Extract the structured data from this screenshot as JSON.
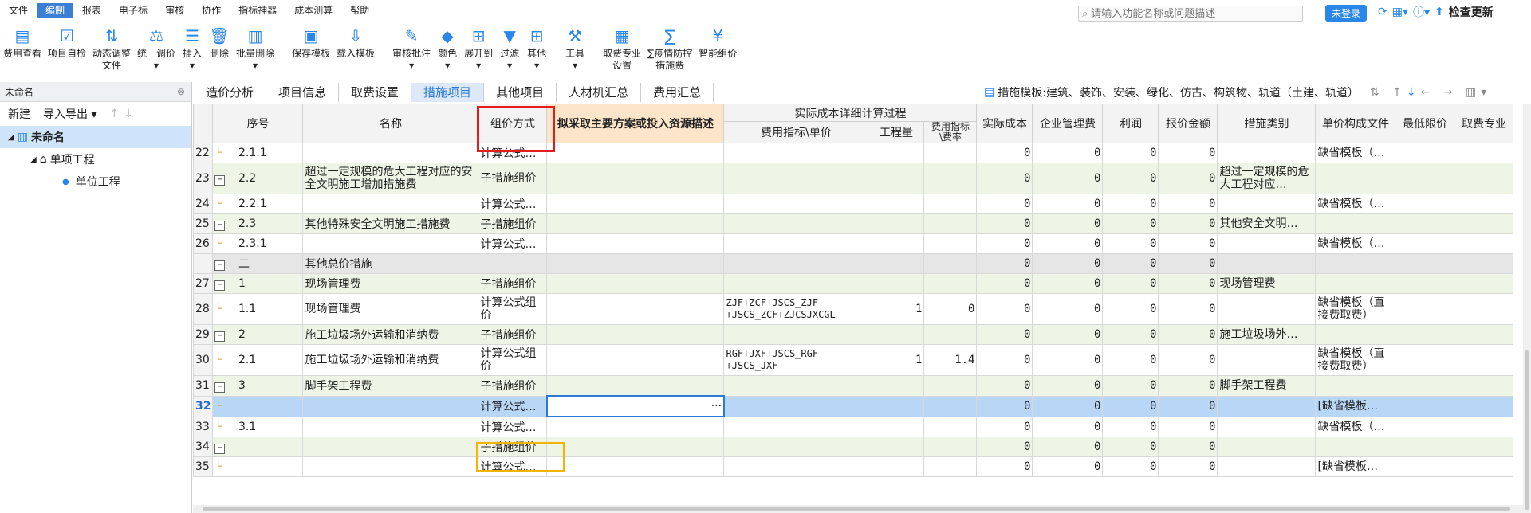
{
  "menu": [
    "文件",
    "编制",
    "报表",
    "电子标",
    "审核",
    "协作",
    "指标神器",
    "成本测算",
    "帮助"
  ],
  "menu_active": 1,
  "search": {
    "placeholder": "请输入功能名称或问题描述"
  },
  "login_label": "未登录",
  "update_label": "检查更新",
  "toolbar": [
    {
      "icon": "fee-view-icon",
      "label": "费用查看"
    },
    {
      "icon": "self-check-icon",
      "label": "项目自检"
    },
    {
      "icon": "dynamic-adjust-icon",
      "label": "动态调整\n文件"
    },
    {
      "icon": "unify-price-icon",
      "label": "统一调价\n▾"
    },
    {
      "icon": "insert-icon",
      "label": "插入\n▾"
    },
    {
      "icon": "delete-icon",
      "label": "删除"
    },
    {
      "icon": "batch-delete-icon",
      "label": "批量删除\n▾"
    },
    {
      "icon": "save-template-icon",
      "label": "保存模板"
    },
    {
      "icon": "load-template-icon",
      "label": "载入模板"
    },
    {
      "icon": "review-icon",
      "label": "审核批注\n▾"
    },
    {
      "icon": "color-icon",
      "label": "颜色\n▾"
    },
    {
      "icon": "expand-icon",
      "label": "展开到\n▾"
    },
    {
      "icon": "filter-icon",
      "label": "过滤\n▾"
    },
    {
      "icon": "other-icon",
      "label": "其他\n▾"
    },
    {
      "icon": "tools-icon",
      "label": "工具\n▾"
    },
    {
      "icon": "fee-setting-icon",
      "label": "取费专业\n设置"
    },
    {
      "icon": "epidemic-fee-icon",
      "label": "∑疫情防控\n措施费"
    },
    {
      "icon": "smart-price-icon",
      "label": "智能组价"
    }
  ],
  "left": {
    "header": "未命名",
    "new_label": "新建",
    "io_label": "导入导出 ▾",
    "tree": [
      {
        "label": "未命名",
        "level": 0
      },
      {
        "label": "单项工程",
        "level": 1
      },
      {
        "label": "单位工程",
        "level": 2
      }
    ]
  },
  "tabs": [
    "造价分析",
    "项目信息",
    "取费设置",
    "措施项目",
    "其他项目",
    "人材机汇总",
    "费用汇总"
  ],
  "tab_active": 3,
  "template_label": "措施模板:建筑、装饰、安装、绿化、仿古、构筑物、轨道（土建、轨道）",
  "grid": {
    "headers": {
      "seq": "序号",
      "name": "名称",
      "method": "组价方式",
      "plan": "拟采取主要方案或投入资源描述",
      "group": "实际成本详细计算过程",
      "indicator": "费用指标\\单价",
      "qty": "工程量",
      "rate": "费用指标\\费率",
      "actual": "实际成本",
      "mgmt": "企业管理费",
      "profit": "利润",
      "quote": "报价金额",
      "category": "措施类别",
      "unitfile": "单价构成文件",
      "minprice": "最低限价",
      "feepro": "取费专业"
    },
    "rows": [
      {
        "n": "22",
        "seq": "2.1.1",
        "minus": false,
        "name": "",
        "method": "计算公式…",
        "ind": "",
        "qty": "",
        "rate": "",
        "actual": "0",
        "mgmt": "0",
        "profit": "0",
        "quote": "0",
        "cat": "",
        "file": "缺省模板（…",
        "style": ""
      },
      {
        "n": "23",
        "seq": "2.2",
        "minus": true,
        "name": "超过一定规模的危大工程对应的安全文明施工增加措施费",
        "method": "子措施组价",
        "ind": "",
        "qty": "",
        "rate": "",
        "actual": "0",
        "mgmt": "0",
        "profit": "0",
        "quote": "0",
        "cat": "超过一定规模的危大工程对应…",
        "file": "",
        "style": "g tall"
      },
      {
        "n": "24",
        "seq": "2.2.1",
        "minus": false,
        "name": "",
        "method": "计算公式…",
        "ind": "",
        "qty": "",
        "rate": "",
        "actual": "0",
        "mgmt": "0",
        "profit": "0",
        "quote": "0",
        "cat": "",
        "file": "缺省模板（…",
        "style": ""
      },
      {
        "n": "25",
        "seq": "2.3",
        "minus": true,
        "name": "其他特殊安全文明施工措施费",
        "method": "子措施组价",
        "ind": "",
        "qty": "",
        "rate": "",
        "actual": "0",
        "mgmt": "0",
        "profit": "0",
        "quote": "0",
        "cat": "其他安全文明…",
        "file": "",
        "style": "g"
      },
      {
        "n": "26",
        "seq": "2.3.1",
        "minus": false,
        "name": "",
        "method": "计算公式…",
        "ind": "",
        "qty": "",
        "rate": "",
        "actual": "0",
        "mgmt": "0",
        "profit": "0",
        "quote": "0",
        "cat": "",
        "file": "缺省模板（…",
        "style": ""
      },
      {
        "n": "",
        "seq": "二",
        "minus": true,
        "name": "其他总价措施",
        "method": "",
        "ind": "",
        "qty": "",
        "rate": "",
        "actual": "0",
        "mgmt": "0",
        "profit": "0",
        "quote": "0",
        "cat": "",
        "file": "",
        "style": "grey"
      },
      {
        "n": "27",
        "seq": "1",
        "minus": true,
        "name": "现场管理费",
        "method": "子措施组价",
        "ind": "",
        "qty": "",
        "rate": "",
        "actual": "0",
        "mgmt": "0",
        "profit": "0",
        "quote": "0",
        "cat": "现场管理费",
        "file": "",
        "style": "g"
      },
      {
        "n": "28",
        "seq": "1.1",
        "minus": false,
        "name": "现场管理费",
        "method": "计算公式组价",
        "ind": "ZJF+ZCF+JSCS_ZJF +JSCS_ZCF+ZJCSJXCGL",
        "qty": "1",
        "rate": "0",
        "actual": "0",
        "mgmt": "0",
        "profit": "0",
        "quote": "0",
        "cat": "",
        "file": "缺省模板（直接费取费）",
        "style": "tall"
      },
      {
        "n": "29",
        "seq": "2",
        "minus": true,
        "name": "施工垃圾场外运输和消纳费",
        "method": "子措施组价",
        "ind": "",
        "qty": "",
        "rate": "",
        "actual": "0",
        "mgmt": "0",
        "profit": "0",
        "quote": "0",
        "cat": "施工垃圾场外…",
        "file": "",
        "style": "g"
      },
      {
        "n": "30",
        "seq": "2.1",
        "minus": false,
        "name": "施工垃圾场外运输和消纳费",
        "method": "计算公式组价",
        "ind": "RGF+JXF+JSCS_RGF +JSCS_JXF",
        "qty": "1",
        "rate": "1.4",
        "actual": "0",
        "mgmt": "0",
        "profit": "0",
        "quote": "0",
        "cat": "",
        "file": "缺省模板（直接费取费）",
        "style": "tall"
      },
      {
        "n": "31",
        "seq": "3",
        "minus": true,
        "name": "脚手架工程费",
        "method": "子措施组价",
        "ind": "",
        "qty": "",
        "rate": "",
        "actual": "0",
        "mgmt": "0",
        "profit": "0",
        "quote": "0",
        "cat": "脚手架工程费",
        "file": "",
        "style": "g"
      },
      {
        "n": "32",
        "seq": "",
        "minus": false,
        "name": "",
        "method": "计算公式…",
        "ind": "",
        "qty": "",
        "rate": "",
        "actual": "0",
        "mgmt": "0",
        "profit": "0",
        "quote": "0",
        "cat": "",
        "file": "[缺省模板…",
        "style": "sel"
      },
      {
        "n": "33",
        "seq": "3.1",
        "minus": false,
        "name": "",
        "method": "计算公式…",
        "ind": "",
        "qty": "",
        "rate": "",
        "actual": "0",
        "mgmt": "0",
        "profit": "0",
        "quote": "0",
        "cat": "",
        "file": "缺省模板（…",
        "style": ""
      },
      {
        "n": "34",
        "seq": "",
        "minus": true,
        "name": "",
        "method": "子措施组价",
        "ind": "",
        "qty": "",
        "rate": "",
        "actual": "0",
        "mgmt": "0",
        "profit": "0",
        "quote": "0",
        "cat": "",
        "file": "",
        "style": "g"
      },
      {
        "n": "35",
        "seq": "",
        "minus": false,
        "name": "",
        "method": "计算公式…",
        "ind": "",
        "qty": "",
        "rate": "",
        "actual": "0",
        "mgmt": "0",
        "profit": "0",
        "quote": "0",
        "cat": "",
        "file": "[缺省模板…",
        "style": ""
      }
    ],
    "selected_cell_ellipsis": "···"
  },
  "colors": {
    "accent": "#2b86ea",
    "red_box": "#e51c1c",
    "yellow_box": "#f5b400",
    "row_green": "#eef5e6",
    "row_selected": "#b8d6f6"
  }
}
